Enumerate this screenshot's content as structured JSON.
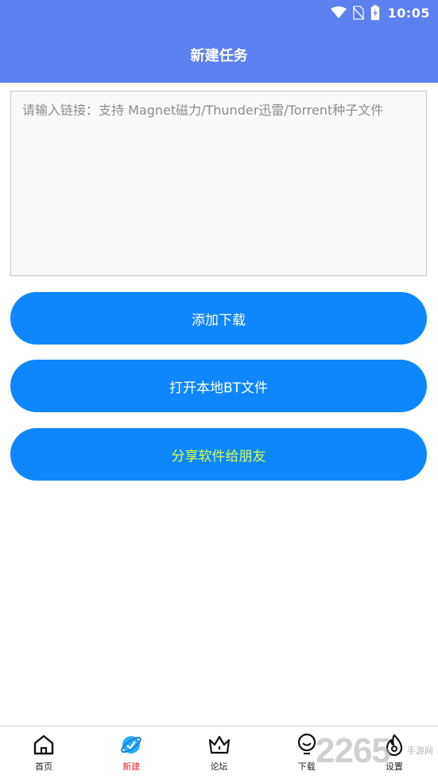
{
  "status_bar": {
    "time": "10:05",
    "icons": [
      "wifi-icon",
      "no-sim-icon",
      "battery-charging-icon"
    ]
  },
  "app_bar": {
    "title": "新建任务",
    "color": "#5b80ef"
  },
  "link_input": {
    "value": "",
    "placeholder": "请输入链接：支持 Magnet磁力/Thunder迅雷/Torrent种子文件"
  },
  "buttons": {
    "add_download": "添加下载",
    "open_local_bt": "打开本地BT文件",
    "share_app": "分享软件给朋友",
    "color": "#0e87fc",
    "share_text_color": "#d9ff3b"
  },
  "bottom_nav": {
    "items": [
      {
        "label": "首页",
        "icon": "home-icon"
      },
      {
        "label": "新建",
        "icon": "planet-icon",
        "active": true
      },
      {
        "label": "论坛",
        "icon": "crown-icon"
      },
      {
        "label": "下载",
        "icon": "lightbulb-icon"
      },
      {
        "label": "设置",
        "icon": "fire-icon"
      }
    ],
    "active_color": "#e0262a"
  },
  "watermark": {
    "number": "2265",
    "text": "手游网"
  }
}
